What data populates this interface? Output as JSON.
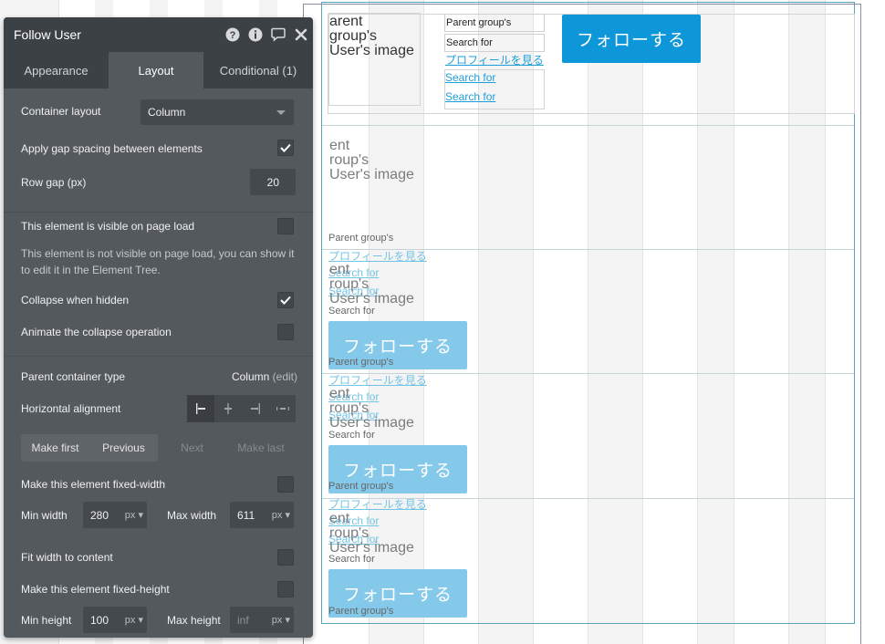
{
  "canvas": {
    "cells": [
      {
        "image_label_lines": [
          "arent",
          "group's",
          "User's image"
        ],
        "text_parent_group": "Parent group's",
        "text_search_for": "Search for",
        "link_view_profile": "プロフィールを見る",
        "link_search_1": "Search for",
        "link_search_2": "Search for",
        "follow_button": "フォローする"
      },
      {
        "image_label_lines": [
          "ent",
          "roup's",
          "User's image"
        ],
        "text_parent_group": "Parent group's",
        "link_view_profile": "プロフィールを見る",
        "link_search_1": "Search for",
        "link_search_2": "Search for"
      },
      {
        "image_label_lines": [
          "ent",
          "roup's",
          "User's image"
        ],
        "text_search_for": "Search for",
        "follow_button": "フォローする",
        "text_parent_group": "Parent group's",
        "link_view_profile": "プロフィールを見る",
        "link_search_1": "Search for",
        "link_search_2": "Search for"
      },
      {
        "image_label_lines": [
          "ent",
          "roup's",
          "User's image"
        ],
        "text_search_for": "Search for",
        "follow_button": "フォローする",
        "text_parent_group": "Parent group's",
        "link_view_profile": "プロフィールを見る",
        "link_search_1": "Search for",
        "link_search_2": "Search for"
      },
      {
        "image_label_lines": [
          "ent",
          "roup's",
          "User's image"
        ],
        "text_search_for": "Search for",
        "follow_button": "フォローする",
        "text_parent_group": "Parent group's"
      }
    ]
  },
  "panel": {
    "title": "Follow User",
    "icons": [
      "help-icon",
      "info-icon",
      "comment-icon",
      "close-icon"
    ],
    "tabs": [
      {
        "label": "Appearance",
        "active": false
      },
      {
        "label": "Layout",
        "active": true
      },
      {
        "label": "Conditional (1)",
        "active": false
      }
    ],
    "container_layout": {
      "label": "Container layout",
      "value": "Column"
    },
    "apply_gap": {
      "label": "Apply gap spacing between elements",
      "checked": true
    },
    "row_gap": {
      "label": "Row gap (px)",
      "value": "20"
    },
    "visible_on_load": {
      "label": "This element is visible on page load",
      "checked": false
    },
    "visible_note": "This element is not visible on page load, you can show it to edit it in the Element Tree.",
    "collapse_hidden": {
      "label": "Collapse when hidden",
      "checked": true
    },
    "animate_collapse": {
      "label": "Animate the collapse operation",
      "checked": false
    },
    "parent_container": {
      "label": "Parent container type",
      "value": "Column",
      "edit": "(edit)"
    },
    "horizontal_alignment": {
      "label": "Horizontal alignment",
      "options": [
        "align-left-icon",
        "align-center-icon",
        "align-right-icon",
        "align-spread-icon"
      ],
      "selected": 0
    },
    "order_buttons": {
      "make_first": "Make first",
      "previous": "Previous",
      "next": "Next",
      "make_last": "Make last"
    },
    "fixed_width": {
      "label": "Make this element fixed-width",
      "checked": false
    },
    "min_width": {
      "label": "Min width",
      "value": "280",
      "unit": "px"
    },
    "max_width": {
      "label": "Max width",
      "value": "611",
      "unit": "px"
    },
    "fit_width": {
      "label": "Fit width to content",
      "checked": false
    },
    "fixed_height": {
      "label": "Make this element fixed-height",
      "checked": false
    },
    "min_height": {
      "label": "Min height",
      "value": "100",
      "unit": "px"
    },
    "max_height": {
      "label": "Max height",
      "placeholder": "inf",
      "unit": "px"
    }
  }
}
